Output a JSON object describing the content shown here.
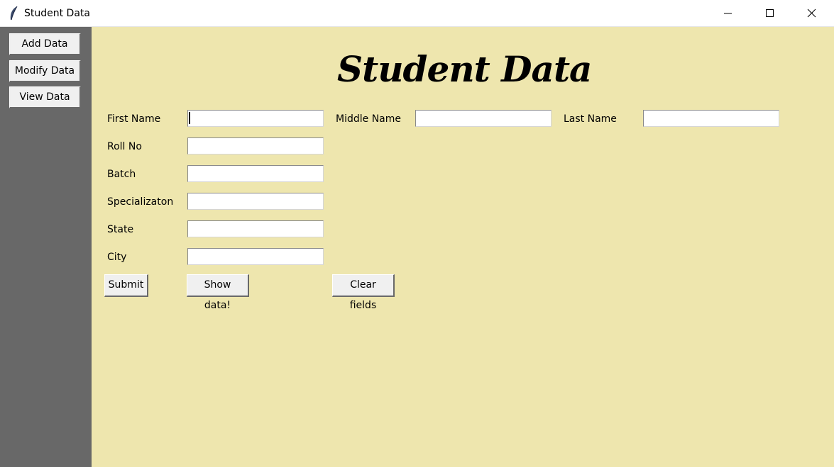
{
  "window": {
    "title": "Student Data",
    "icon": "feather-icon",
    "controls": [
      "minimize-icon",
      "maximize-icon",
      "close-icon"
    ]
  },
  "sidebar": {
    "buttons": [
      {
        "label": "Add Data"
      },
      {
        "label": "Modify Data"
      },
      {
        "label": "View Data"
      }
    ]
  },
  "main": {
    "title": "Student Data",
    "fields": {
      "first_name": {
        "label": "First Name",
        "value": ""
      },
      "middle_name": {
        "label": "Middle Name",
        "value": ""
      },
      "last_name": {
        "label": "Last Name",
        "value": ""
      },
      "roll_no": {
        "label": "Roll No",
        "value": ""
      },
      "batch": {
        "label": "Batch",
        "value": ""
      },
      "specialization": {
        "label": "Specializaton",
        "value": ""
      },
      "state": {
        "label": "State",
        "value": ""
      },
      "city": {
        "label": "City",
        "value": ""
      }
    },
    "buttons": {
      "submit": "Submit",
      "show": "Show data!",
      "clear": "Clear fields"
    }
  },
  "colors": {
    "sidebar_bg": "#686868",
    "main_bg": "#eee6ae",
    "button_bg": "#f0f0f0"
  }
}
